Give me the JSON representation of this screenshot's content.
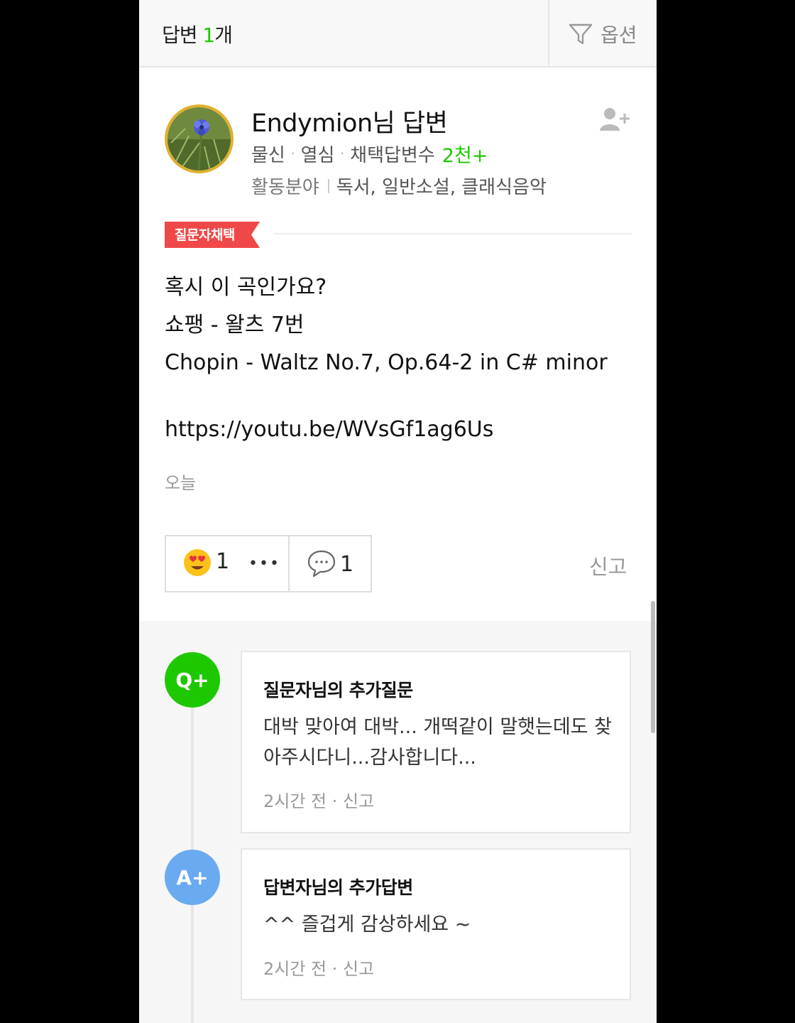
{
  "header": {
    "title_prefix": "답변 ",
    "title_count": "1",
    "title_suffix": "개",
    "options_label": "옵션"
  },
  "answer": {
    "author": "Endymion님 답변",
    "rank": "물신",
    "status": "열심",
    "adopted_label": "채택답변수",
    "adopted_count": "2천+",
    "fields_label": "활동분야",
    "fields_value": "독서, 일반소설, 클래식음악",
    "badge": "질문자채택",
    "body": "혹시 이 곡인가요?\n쇼팽 - 왈츠 7번\nChopin - Waltz No.7, Op.64-2 in C# minor",
    "link": "https://youtu.be/WVsGf1ag6Us",
    "date": "오늘",
    "like_count": "1",
    "more": "•••",
    "comment_count": "1",
    "report": "신고"
  },
  "thread": [
    {
      "icon": "Q+",
      "title": "질문자님의 추가질문",
      "text": "대박 맞아여 대박... 개떡같이 말햇는데도 찾아주시다니...감사합니다...",
      "meta": "2시간 전 · 신고"
    },
    {
      "icon": "A+",
      "title": "답변자님의 추가답변",
      "text": "^^ 즐겁게 감상하세요 ~",
      "meta": "2시간 전 · 신고"
    }
  ],
  "colors": {
    "accent_green": "#1ec800",
    "badge_red": "#f04848",
    "answer_blue": "#6aaaf0"
  }
}
